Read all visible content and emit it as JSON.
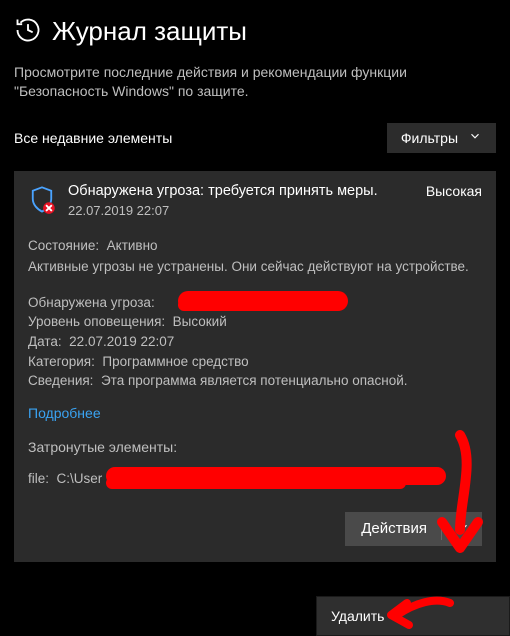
{
  "header": {
    "title": "Журнал защиты",
    "subtitle": "Просмотрите последние действия и рекомендации функции \"Безопасность Windows\" по защите."
  },
  "toolbar": {
    "recent_label": "Все недавние элементы",
    "filters_label": "Фильтры"
  },
  "threat": {
    "title": "Обнаружена угроза: требуется принять меры.",
    "timestamp": "22.07.2019 22:07",
    "severity": "Высокая",
    "status_label": "Состояние:",
    "status_value": "Активно",
    "status_desc": "Активные угрозы не устранены. Они сейчас действуют на устройстве.",
    "detected_label": "Обнаружена угроза:",
    "detected_value": "",
    "alert_level_label": "Уровень оповещения:",
    "alert_level_value": "Высокий",
    "date_label": "Дата:",
    "date_value": "22.07.2019 22:07",
    "category_label": "Категория:",
    "category_value": "Программное средство",
    "info_label": "Сведения:",
    "info_value": "Эта программа является потенциально опасной.",
    "more_label": "Подробнее",
    "affected_label": "Затронутые элементы:",
    "file_label": "file:",
    "file_value": "C:\\User",
    "actions_label": "Действия"
  },
  "menu": {
    "delete_label": "Удалить"
  }
}
